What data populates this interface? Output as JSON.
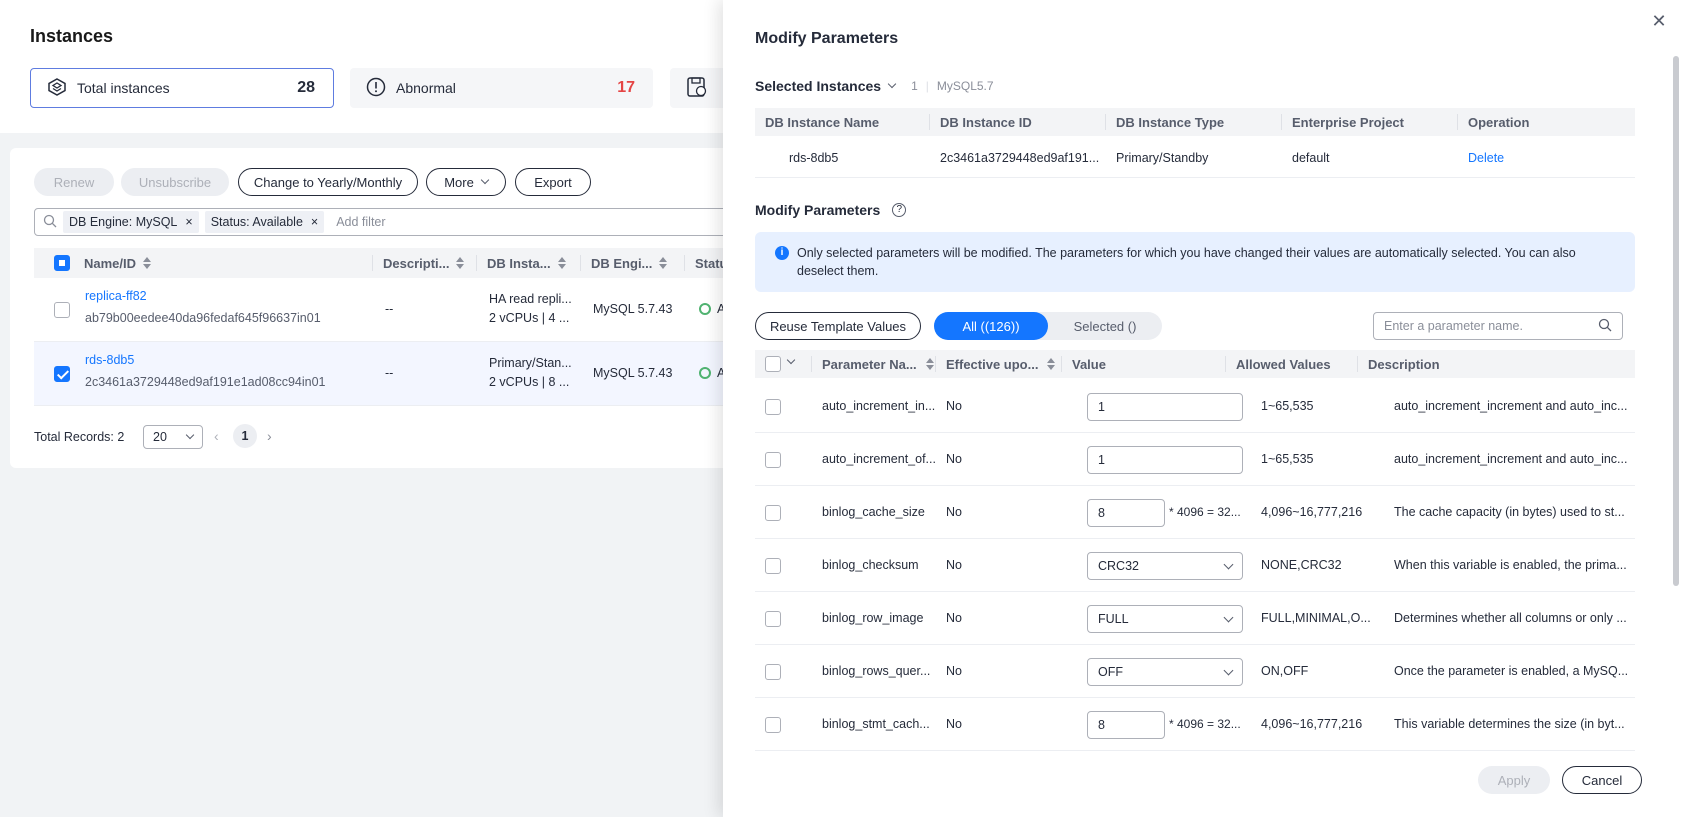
{
  "page": {
    "title": "Instances",
    "stats": [
      {
        "label": "Total instances",
        "count": "28"
      },
      {
        "label": "Abnormal",
        "count": "17"
      }
    ],
    "stat_colors": {
      "abnormal": "#e54545",
      "link": "#1476ff"
    }
  },
  "toolbar": {
    "renew": "Renew",
    "unsubscribe": "Unsubscribe",
    "change": "Change to Yearly/Monthly",
    "more": "More",
    "export": "Export"
  },
  "filter": {
    "chips": [
      "DB Engine: MySQL",
      "Status: Available"
    ],
    "placeholder": "Add filter"
  },
  "table": {
    "headers": [
      "Name/ID",
      "Descripti...",
      "DB Insta...",
      "DB Engi...",
      "Statu"
    ],
    "rows": [
      {
        "name": "replica-ff82",
        "id": "ab79b00eedee40da96fedaf645f96637in01",
        "desc": "--",
        "type1": "HA read repli...",
        "type2": "2 vCPUs | 4 ...",
        "engine": "MySQL 5.7.43",
        "status": "A"
      },
      {
        "name": "rds-8db5",
        "id": "2c3461a3729448ed9af191e1ad08cc94in01",
        "desc": "--",
        "type1": "Primary/Stan...",
        "type2": "2 vCPUs | 8 ...",
        "engine": "MySQL 5.7.43",
        "status": "A"
      }
    ]
  },
  "pager": {
    "total": "Total Records: 2",
    "size": "20",
    "page": "1"
  },
  "drawer": {
    "title": "Modify Parameters",
    "selected": {
      "title": "Selected Instances",
      "count": "1",
      "engine": "MySQL5.7",
      "headers": [
        "DB Instance Name",
        "DB Instance ID",
        "DB Instance Type",
        "Enterprise Project",
        "Operation"
      ],
      "row": {
        "name": "rds-8db5",
        "id": "2c3461a3729448ed9af191...",
        "type": "Primary/Standby",
        "project": "default",
        "op": "Delete"
      }
    },
    "params": {
      "title": "Modify Parameters",
      "info": "Only selected parameters will be modified. The parameters for which you have changed their values are automatically selected. You can also deselect them.",
      "reuse": "Reuse Template Values",
      "tab_all": "All ((126))",
      "tab_selected": "Selected ()",
      "search_placeholder": "Enter a parameter name.",
      "headers": [
        "Parameter Na...",
        "Effective upo...",
        "Value",
        "Allowed Values",
        "Description"
      ],
      "rows": [
        {
          "name": "auto_increment_in...",
          "eff": "No",
          "value": "1",
          "kind": "input",
          "suffix": "",
          "allowed": "1~65,535",
          "desc": "auto_increment_increment and auto_inc..."
        },
        {
          "name": "auto_increment_of...",
          "eff": "No",
          "value": "1",
          "kind": "input",
          "suffix": "",
          "allowed": "1~65,535",
          "desc": "auto_increment_increment and auto_inc..."
        },
        {
          "name": "binlog_cache_size",
          "eff": "No",
          "value": "8",
          "kind": "small",
          "suffix": "* 4096 = 32...",
          "allowed": "4,096~16,777,216",
          "desc": "The cache capacity (in bytes) used to st..."
        },
        {
          "name": "binlog_checksum",
          "eff": "No",
          "value": "CRC32",
          "kind": "select",
          "suffix": "",
          "allowed": "NONE,CRC32",
          "desc": "When this variable is enabled, the prima..."
        },
        {
          "name": "binlog_row_image",
          "eff": "No",
          "value": "FULL",
          "kind": "select",
          "suffix": "",
          "allowed": "FULL,MINIMAL,O...",
          "desc": "Determines whether all columns or only ..."
        },
        {
          "name": "binlog_rows_quer...",
          "eff": "No",
          "value": "OFF",
          "kind": "select",
          "suffix": "",
          "allowed": "ON,OFF",
          "desc": "Once the parameter is enabled, a MySQ..."
        },
        {
          "name": "binlog_stmt_cach...",
          "eff": "No",
          "value": "8",
          "kind": "small",
          "suffix": "* 4096 = 32...",
          "allowed": "4,096~16,777,216",
          "desc": "This variable determines the size (in byt..."
        }
      ]
    },
    "apply": "Apply",
    "cancel": "Cancel"
  }
}
